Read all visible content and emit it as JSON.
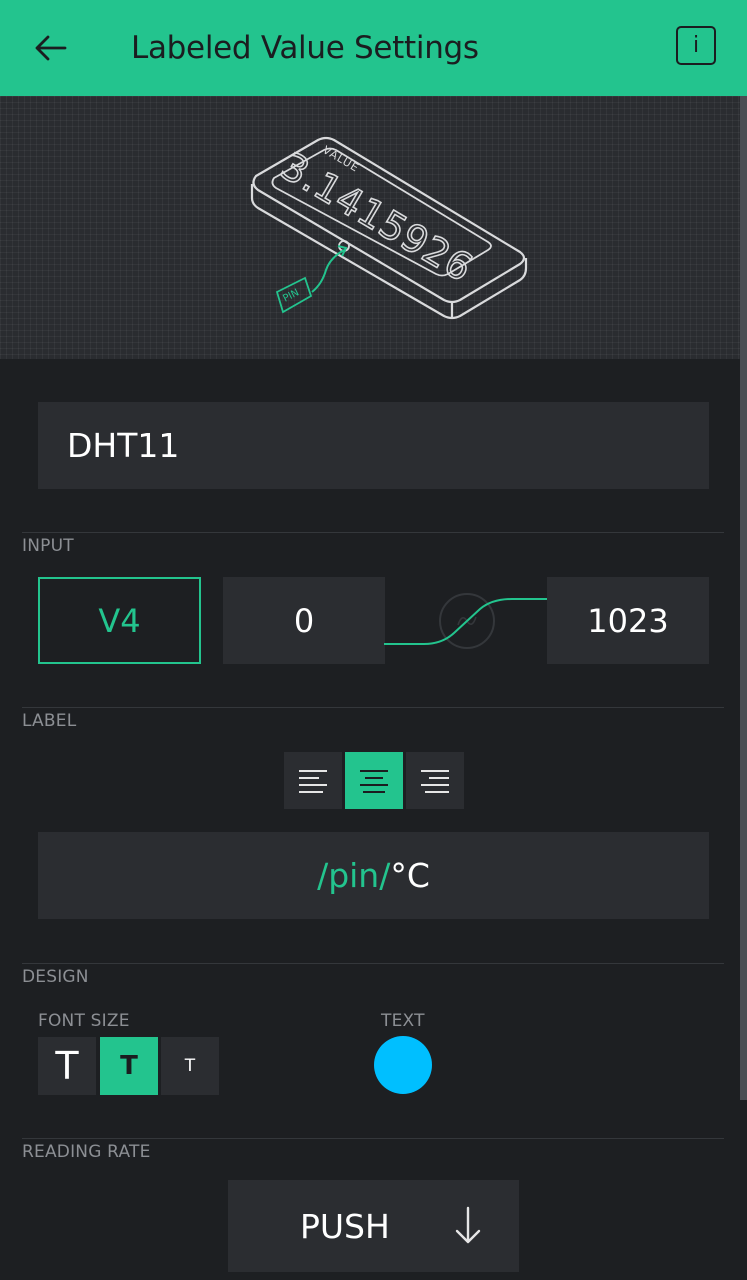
{
  "header": {
    "title": "Labeled Value Settings",
    "info_label": "i"
  },
  "preview": {
    "value_caption": "VALUE",
    "value_text": "3.1415926",
    "pin_caption": "PIN"
  },
  "name_field": {
    "value": "DHT11"
  },
  "input_section": {
    "label": "INPUT",
    "pin": "V4",
    "min": "0",
    "max": "1023"
  },
  "label_section": {
    "label": "LABEL",
    "alignment": "center",
    "value_pin_part": "/pin/",
    "value_suffix": "°C"
  },
  "design_section": {
    "label": "DESIGN",
    "font_size_label": "FONT SIZE",
    "font_sizes": [
      "T",
      "T",
      "T"
    ],
    "selected_font_size": "medium",
    "text_color_label": "TEXT",
    "text_color": "#00bfff"
  },
  "reading_rate": {
    "label": "READING RATE",
    "value": "PUSH"
  },
  "colors": {
    "accent": "#23c48e",
    "background": "#1d1f22",
    "field": "#2b2d31"
  }
}
